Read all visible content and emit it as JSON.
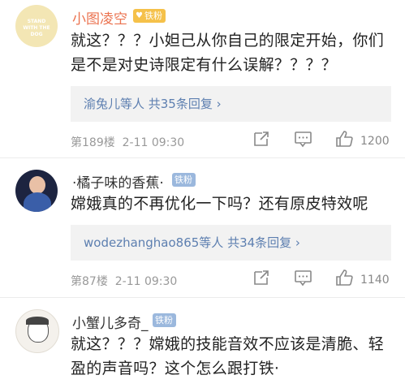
{
  "comments": [
    {
      "username": "小图凌空",
      "badge": "铁粉",
      "avatar_text": "STAND WITH THE DOG",
      "text": "就这？？？小妲己从你自己的限定开始，你们是不是对史诗限定有什么误解？？？？",
      "reply_summary": "渝兔儿等人  共35条回复 ›",
      "floor": "第189楼",
      "time": "2-11 09:30",
      "likes": "1200"
    },
    {
      "username": "·橘子味的香蕉·",
      "badge": "铁粉",
      "text": "嫦娥真的不再优化一下吗？还有原皮特效呢",
      "reply_summary": "wodezhanghao865等人  共34条回复 ›",
      "floor": "第87楼",
      "time": "2-11 09:30",
      "likes": "1140"
    },
    {
      "username": "小蟹儿多奇_",
      "badge": "铁粉",
      "text": "就这？？？嫦娥的技能音效不应该是清脆、轻盈的声音吗？这个怎么跟打铁·"
    }
  ],
  "colors": {
    "name": "#eb7350",
    "link": "#5d7fb0",
    "muted": "#999999",
    "badge_gold": "#f5c14a",
    "badge_blue": "#9bb8dd"
  }
}
